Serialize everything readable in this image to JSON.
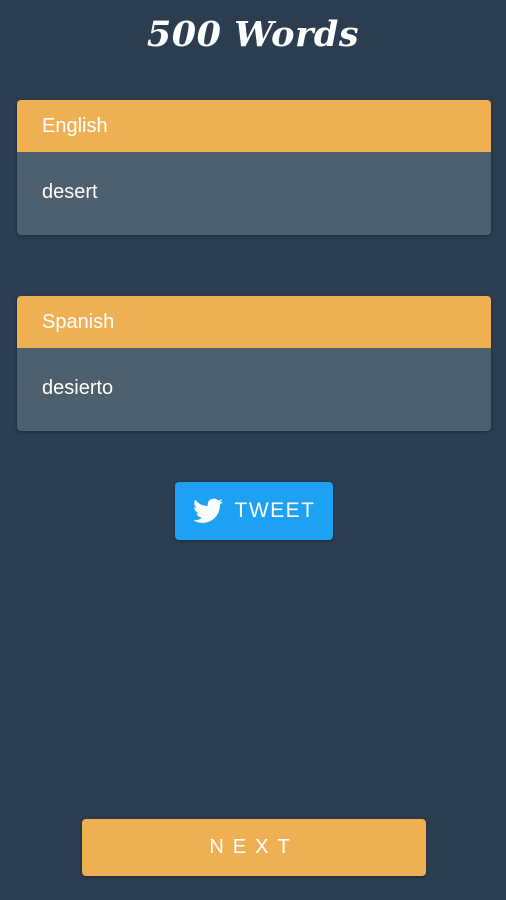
{
  "app": {
    "title": "500 Words"
  },
  "cards": {
    "source": {
      "language": "English",
      "word": "desert"
    },
    "target": {
      "language": "Spanish",
      "word": "desierto"
    }
  },
  "actions": {
    "tweet_label": "TWEET",
    "tweet_icon": "twitter-bird-icon",
    "next_label": "NEXT"
  },
  "colors": {
    "background": "#2b3d4f",
    "accent": "#efb054",
    "card_body": "#4e5f6e",
    "twitter_blue": "#1da1f2"
  }
}
